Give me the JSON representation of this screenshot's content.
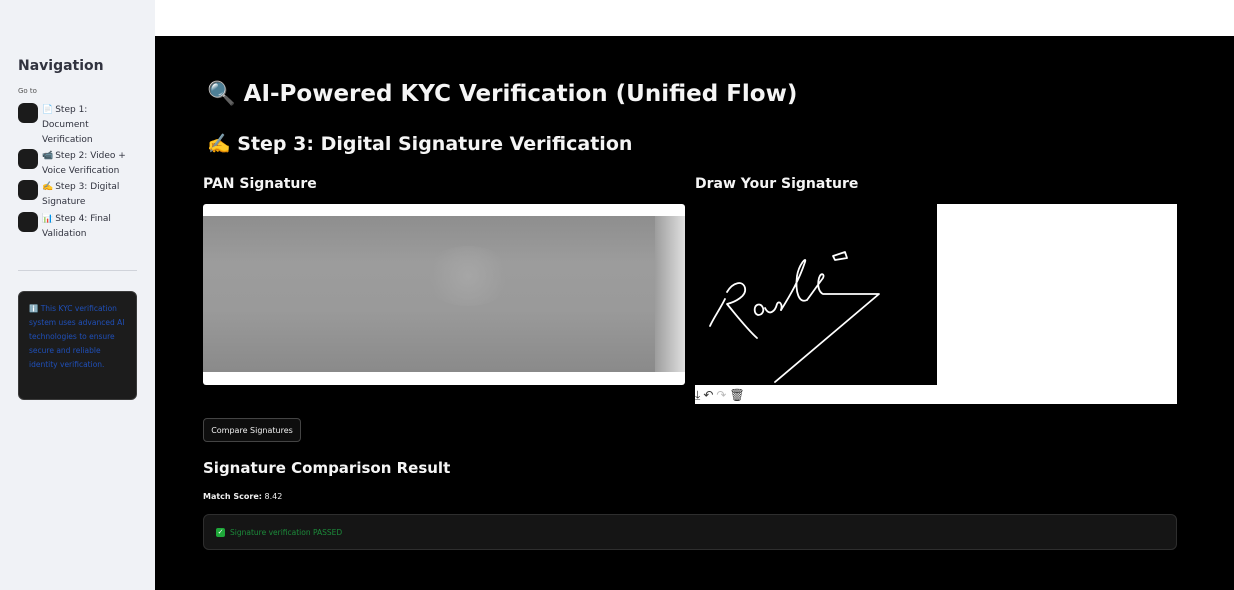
{
  "sidebar": {
    "title": "Navigation",
    "goto_label": "Go to",
    "items": [
      {
        "icon": "document-icon",
        "glyph": "📄",
        "label": "Step 1: Document Verification"
      },
      {
        "icon": "video-icon",
        "glyph": "📹",
        "label": "Step 2: Video + Voice Verification"
      },
      {
        "icon": "writing-hand-icon",
        "glyph": "✍️",
        "label": "Step 3: Digital Signature"
      },
      {
        "icon": "chart-icon",
        "glyph": "📊",
        "label": "Step 4: Final Validation"
      }
    ],
    "info": "ℹ️ This KYC verification system uses advanced AI technologies to ensure secure and reliable identity verification."
  },
  "main": {
    "title": "🔍 AI-Powered KYC Verification (Unified Flow)",
    "step_title": "✍️ Step 3: Digital Signature Verification",
    "pan_label": "PAN Signature",
    "draw_label": "Draw Your Signature",
    "compare_button": "Compare Signatures",
    "result_title": "Signature Comparison Result",
    "match_score_label": "Match Score:",
    "match_score_value": "8.42",
    "success_message": "Signature verification PASSED",
    "toolbar": {
      "download": "⤓",
      "undo": "↶",
      "redo": "↷",
      "delete": "🗑"
    }
  },
  "colors": {
    "main_bg": "#000000",
    "sidebar_bg": "#f0f2f6",
    "success_green": "#1c8a3a",
    "info_blue": "#1f4fb8"
  }
}
